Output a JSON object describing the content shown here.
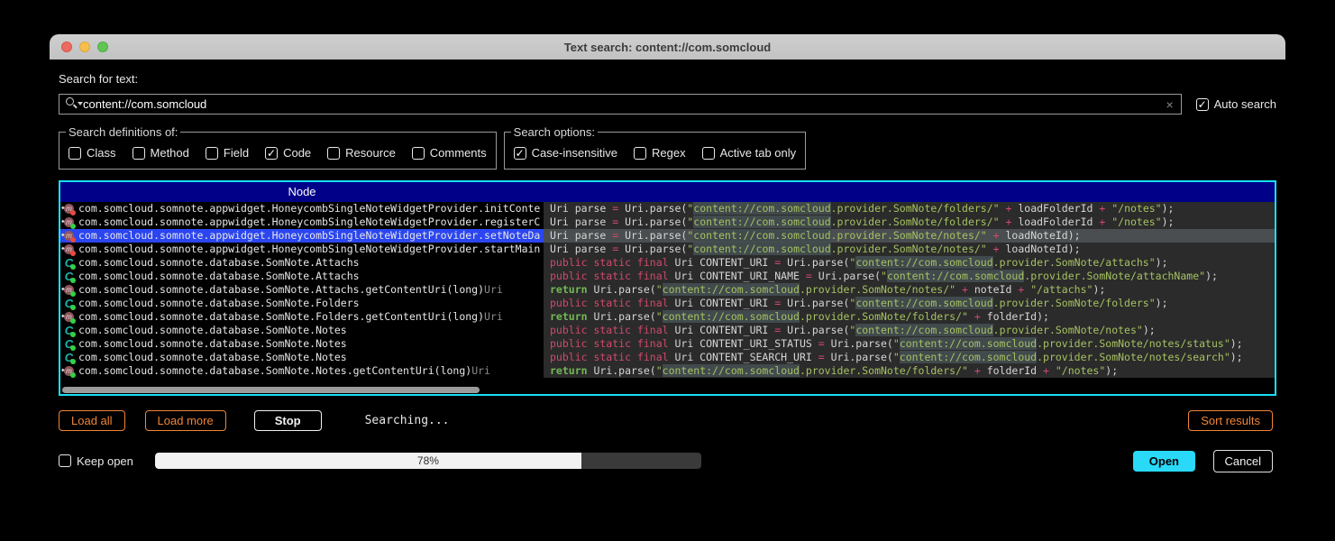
{
  "window": {
    "title": "Text search: content://com.somcloud"
  },
  "search": {
    "label": "Search for text:",
    "value": "content://com.somcloud",
    "clear_icon": "×",
    "auto_search_label": "Auto search",
    "auto_search_checked": true
  },
  "definitions": {
    "legend": "Search definitions of:",
    "items": [
      {
        "label": "Class",
        "checked": false
      },
      {
        "label": "Method",
        "checked": false
      },
      {
        "label": "Field",
        "checked": false
      },
      {
        "label": "Code",
        "checked": true
      },
      {
        "label": "Resource",
        "checked": false
      },
      {
        "label": "Comments",
        "checked": false
      }
    ]
  },
  "options": {
    "legend": "Search options:",
    "items": [
      {
        "label": "Case-insensitive",
        "checked": true
      },
      {
        "label": "Regex",
        "checked": false
      },
      {
        "label": "Active tab only",
        "checked": false
      }
    ]
  },
  "results": {
    "header": "Node",
    "rows": [
      {
        "icon": "method-private",
        "node": "com.somcloud.somnote.appwidget.HoneycombSingleNoteWidgetProvider.initConte",
        "suffix": "",
        "selected": false,
        "code": [
          [
            "i",
            "Uri parse "
          ],
          [
            "o",
            "="
          ],
          [
            "i",
            " Uri.parse("
          ],
          [
            "s",
            "\""
          ],
          [
            "h",
            "content://com.somcloud"
          ],
          [
            "s",
            ".provider.SomNote/folders/\""
          ],
          [
            "o",
            " + "
          ],
          [
            "i",
            "loadFolderId"
          ],
          [
            "o",
            " + "
          ],
          [
            "s",
            "\"/notes\""
          ],
          [
            "i",
            ");"
          ]
        ]
      },
      {
        "icon": "method-public",
        "node": "com.somcloud.somnote.appwidget.HoneycombSingleNoteWidgetProvider.registerC",
        "suffix": "",
        "selected": false,
        "code": [
          [
            "i",
            "Uri parse "
          ],
          [
            "o",
            "="
          ],
          [
            "i",
            " Uri.parse("
          ],
          [
            "s",
            "\""
          ],
          [
            "h",
            "content://com.somcloud"
          ],
          [
            "s",
            ".provider.SomNote/folders/\""
          ],
          [
            "o",
            " + "
          ],
          [
            "i",
            "loadFolderId"
          ],
          [
            "o",
            " + "
          ],
          [
            "s",
            "\"/notes\""
          ],
          [
            "i",
            ");"
          ]
        ]
      },
      {
        "icon": "method-private",
        "node": "com.somcloud.somnote.appwidget.HoneycombSingleNoteWidgetProvider.setNoteDa",
        "suffix": "",
        "selected": true,
        "code": [
          [
            "i",
            "Uri parse "
          ],
          [
            "o",
            "="
          ],
          [
            "i",
            " Uri.parse("
          ],
          [
            "s",
            "\""
          ],
          [
            "h",
            "content://com.somcloud"
          ],
          [
            "s",
            ".provider.SomNote/notes/\""
          ],
          [
            "o",
            " + "
          ],
          [
            "i",
            "loadNoteId"
          ],
          [
            "i",
            ");"
          ]
        ]
      },
      {
        "icon": "method-private",
        "node": "com.somcloud.somnote.appwidget.HoneycombSingleNoteWidgetProvider.startMain",
        "suffix": "",
        "selected": false,
        "code": [
          [
            "i",
            "Uri parse "
          ],
          [
            "o",
            "="
          ],
          [
            "i",
            " Uri.parse("
          ],
          [
            "s",
            "\""
          ],
          [
            "h",
            "content://com.somcloud"
          ],
          [
            "s",
            ".provider.SomNote/notes/\""
          ],
          [
            "o",
            " + "
          ],
          [
            "i",
            "loadNoteId"
          ],
          [
            "i",
            ");"
          ]
        ]
      },
      {
        "icon": "class",
        "node": "com.somcloud.somnote.database.SomNote.Attachs",
        "suffix": "",
        "selected": false,
        "code": [
          [
            "k",
            "public static final"
          ],
          [
            "i",
            " Uri CONTENT_URI "
          ],
          [
            "o",
            "="
          ],
          [
            "i",
            " Uri.parse("
          ],
          [
            "s",
            "\""
          ],
          [
            "h",
            "content://com.somcloud"
          ],
          [
            "s",
            ".provider.SomNote/attachs\""
          ],
          [
            "i",
            ");"
          ]
        ]
      },
      {
        "icon": "class",
        "node": "com.somcloud.somnote.database.SomNote.Attachs",
        "suffix": "",
        "selected": false,
        "code": [
          [
            "k",
            "public static final"
          ],
          [
            "i",
            " Uri CONTENT_URI_NAME "
          ],
          [
            "o",
            "="
          ],
          [
            "i",
            " Uri.parse("
          ],
          [
            "s",
            "\""
          ],
          [
            "h",
            "content://com.somcloud"
          ],
          [
            "s",
            ".provider.SomNote/attachName\""
          ],
          [
            "i",
            ");"
          ]
        ]
      },
      {
        "icon": "method-public",
        "node": "com.somcloud.somnote.database.SomNote.Attachs.getContentUri(long) ",
        "suffix": "Uri",
        "selected": false,
        "code": [
          [
            "r",
            "return"
          ],
          [
            "i",
            " Uri.parse("
          ],
          [
            "s",
            "\""
          ],
          [
            "h",
            "content://com.somcloud"
          ],
          [
            "s",
            ".provider.SomNote/notes/\""
          ],
          [
            "o",
            " + "
          ],
          [
            "i",
            "noteId"
          ],
          [
            "o",
            " + "
          ],
          [
            "s",
            "\"/attachs\""
          ],
          [
            "i",
            ");"
          ]
        ]
      },
      {
        "icon": "class",
        "node": "com.somcloud.somnote.database.SomNote.Folders",
        "suffix": "",
        "selected": false,
        "code": [
          [
            "k",
            "public static final"
          ],
          [
            "i",
            " Uri CONTENT_URI "
          ],
          [
            "o",
            "="
          ],
          [
            "i",
            " Uri.parse("
          ],
          [
            "s",
            "\""
          ],
          [
            "h",
            "content://com.somcloud"
          ],
          [
            "s",
            ".provider.SomNote/folders\""
          ],
          [
            "i",
            ");"
          ]
        ]
      },
      {
        "icon": "method-public",
        "node": "com.somcloud.somnote.database.SomNote.Folders.getContentUri(long) ",
        "suffix": "Uri",
        "selected": false,
        "code": [
          [
            "r",
            "return"
          ],
          [
            "i",
            " Uri.parse("
          ],
          [
            "s",
            "\""
          ],
          [
            "h",
            "content://com.somcloud"
          ],
          [
            "s",
            ".provider.SomNote/folders/\""
          ],
          [
            "o",
            " + "
          ],
          [
            "i",
            "folderId"
          ],
          [
            "i",
            ");"
          ]
        ]
      },
      {
        "icon": "class",
        "node": "com.somcloud.somnote.database.SomNote.Notes",
        "suffix": "",
        "selected": false,
        "code": [
          [
            "k",
            "public static final"
          ],
          [
            "i",
            " Uri CONTENT_URI "
          ],
          [
            "o",
            "="
          ],
          [
            "i",
            " Uri.parse("
          ],
          [
            "s",
            "\""
          ],
          [
            "h",
            "content://com.somcloud"
          ],
          [
            "s",
            ".provider.SomNote/notes\""
          ],
          [
            "i",
            ");"
          ]
        ]
      },
      {
        "icon": "class",
        "node": "com.somcloud.somnote.database.SomNote.Notes",
        "suffix": "",
        "selected": false,
        "code": [
          [
            "k",
            "public static final"
          ],
          [
            "i",
            " Uri CONTENT_URI_STATUS "
          ],
          [
            "o",
            "="
          ],
          [
            "i",
            " Uri.parse("
          ],
          [
            "s",
            "\""
          ],
          [
            "h",
            "content://com.somcloud"
          ],
          [
            "s",
            ".provider.SomNote/notes/status\""
          ],
          [
            "i",
            ");"
          ]
        ]
      },
      {
        "icon": "class",
        "node": "com.somcloud.somnote.database.SomNote.Notes",
        "suffix": "",
        "selected": false,
        "code": [
          [
            "k",
            "public static final"
          ],
          [
            "i",
            " Uri CONTENT_SEARCH_URI "
          ],
          [
            "o",
            "="
          ],
          [
            "i",
            " Uri.parse("
          ],
          [
            "s",
            "\""
          ],
          [
            "h",
            "content://com.somcloud"
          ],
          [
            "s",
            ".provider.SomNote/notes/search\""
          ],
          [
            "i",
            ");"
          ]
        ]
      },
      {
        "icon": "method-public",
        "node": "com.somcloud.somnote.database.SomNote.Notes.getContentUri(long) ",
        "suffix": "Uri",
        "selected": false,
        "code": [
          [
            "r",
            "return"
          ],
          [
            "i",
            " Uri.parse("
          ],
          [
            "s",
            "\""
          ],
          [
            "h",
            "content://com.somcloud"
          ],
          [
            "s",
            ".provider.SomNote/folders/\""
          ],
          [
            "o",
            " + "
          ],
          [
            "i",
            "folderId"
          ],
          [
            "o",
            " + "
          ],
          [
            "s",
            "\"/notes\""
          ],
          [
            "i",
            ");"
          ]
        ]
      }
    ]
  },
  "actions": {
    "load_all": "Load all",
    "load_more": "Load more",
    "stop": "Stop",
    "status": "Searching...",
    "sort_results": "Sort results"
  },
  "footer": {
    "keep_open_label": "Keep open",
    "keep_open_checked": false,
    "progress_label": "78%",
    "progress_value": 78,
    "open": "Open",
    "cancel": "Cancel"
  },
  "colors": {
    "accent_cyan": "#17dff6",
    "selection_blue": "#2b46f0",
    "header_navy": "#000089",
    "orange": "#f08437",
    "open_button": "#29d9f7",
    "string": "#a5c261",
    "keyword": "#d1496b",
    "return_keyword": "#73b855",
    "code_bg": "#2b2b2b"
  }
}
